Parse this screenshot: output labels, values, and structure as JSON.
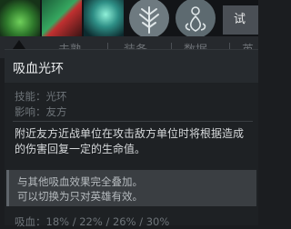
{
  "hero_icons": [
    {
      "name": "hero-portrait-1"
    },
    {
      "name": "hero-portrait-2"
    },
    {
      "name": "hero-portrait-3"
    }
  ],
  "talent_icons": [
    {
      "name": "tree-icon"
    },
    {
      "name": "sun-lotus-icon"
    }
  ],
  "try_button": "试",
  "tabs": [
    "未熟",
    "装备",
    "数据",
    "英雄"
  ],
  "tooltip": {
    "title": "吸血光环",
    "skill_label": "技能：光环",
    "affect_label": "影响：友方",
    "description": "附近友方近战单位在攻击敌方单位时将根据造成的伤害回复一定的生命值。",
    "notes": [
      "与其他吸血效果完全叠加。",
      "可以切换为只对英雄有效。"
    ],
    "lifesteal": "吸血：18% / 22% / 26% / 30%"
  },
  "colors": {
    "background": "#1b1d20",
    "panel": "#262a2e",
    "note": "#3a3e42"
  }
}
